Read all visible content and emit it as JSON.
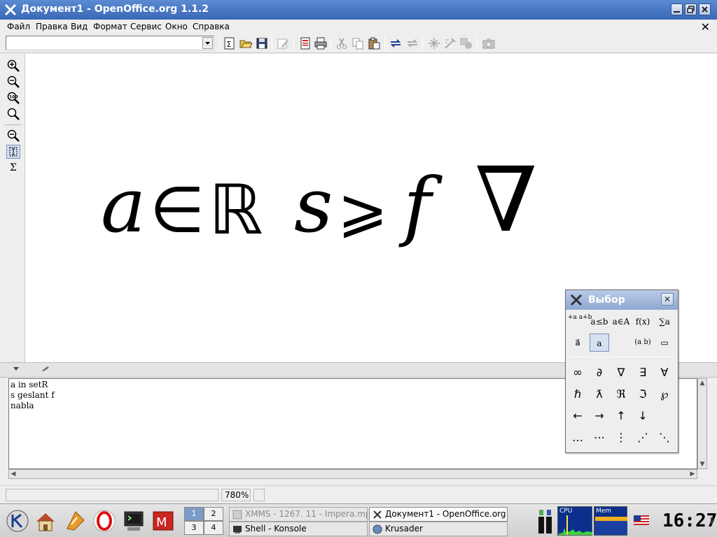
{
  "window": {
    "title": "Документ1 - OpenOffice.org 1.1.2",
    "menu": [
      "Файл",
      "Правка",
      "Вид",
      "Формат",
      "Сервис",
      "Окно",
      "Справка"
    ]
  },
  "toolbar": {
    "combo_value": "",
    "icons": [
      "formula-icon",
      "open-icon",
      "save-icon",
      "edit-icon",
      "pdf-export-icon",
      "print-icon",
      "cut-icon",
      "copy-icon",
      "paste-icon",
      "undo-icon",
      "redo-icon",
      "navigator-icon",
      "draw-icon",
      "gallery-icon",
      "camera-icon"
    ]
  },
  "left_toolbar": {
    "icons": [
      "zoom-in-icon",
      "zoom-out-icon",
      "zoom-100-icon",
      "zoom-all-icon",
      "zoom-out-icon",
      "formula-cursor-icon",
      "sigma-icon"
    ]
  },
  "formula": {
    "tokens": [
      "a",
      "∈",
      "ℝ",
      "s",
      "⩾",
      "f",
      "∇"
    ]
  },
  "commands": [
    "a in setR",
    "s geslant f",
    "nabla"
  ],
  "status": {
    "zoom": "780%"
  },
  "selection_dialog": {
    "title": "Выбор",
    "categories_row1": [
      "+a a+b",
      "a≤b",
      "a∈A",
      "f(x)",
      "∑a"
    ],
    "categories_row2": [
      "a⃗",
      "a",
      "(a b)",
      "▭"
    ],
    "symbols": [
      [
        "∞",
        "∂",
        "∇",
        "∃",
        "∀"
      ],
      [
        "ℏ",
        "ƛ",
        "ℜ",
        "ℑ",
        "℘"
      ],
      [
        "←",
        "→",
        "↑",
        "↓",
        ""
      ],
      [
        "…",
        "⋯",
        "⋮",
        "⋰",
        "⋱"
      ]
    ]
  },
  "taskbar": {
    "pager": [
      "1",
      "2",
      "3",
      "4"
    ],
    "tasks": [
      {
        "label": "XMMS - 1267. 11 - Impera.mp",
        "state": "inactive"
      },
      {
        "label": "Документ1 - OpenOffice.org",
        "state": "active"
      },
      {
        "label": "Shell - Konsole",
        "state": "normal"
      },
      {
        "label": "Krusader",
        "state": "normal"
      }
    ],
    "tray": {
      "cpu_label": "CPU",
      "mem_label": "Mem"
    },
    "clock": "16:27"
  }
}
